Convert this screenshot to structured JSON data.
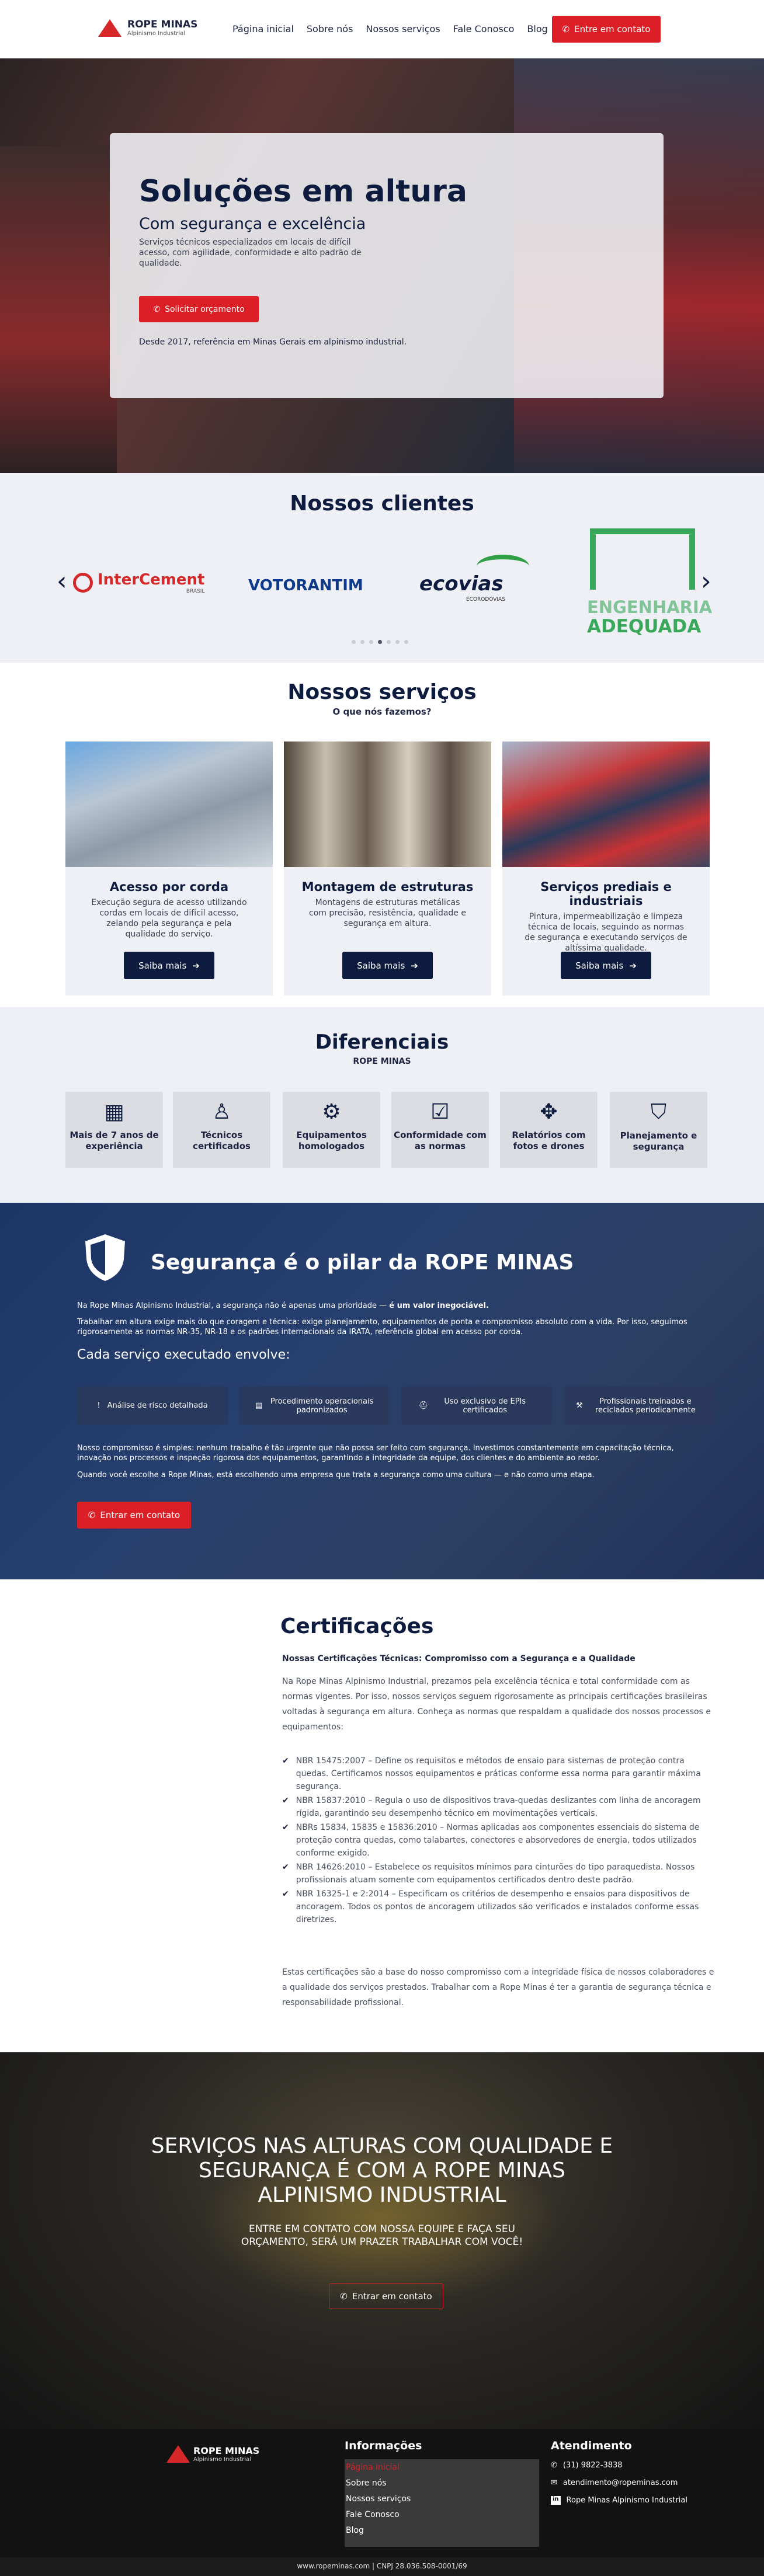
{
  "header": {
    "logo_title": "ROPE MINAS",
    "logo_subtitle": "Alpinismo Industrial",
    "nav": [
      "Página inicial",
      "Sobre nós",
      "Nossos serviços",
      "Fale Conosco",
      "Blog"
    ],
    "cta_label": "Entre em contato"
  },
  "hero": {
    "title": "Soluções em altura",
    "subtitle": "Com segurança e excelência",
    "description": "Serviços técnicos especializados em locais de difícil acesso, com agilidade, conformidade e alto padrão de qualidade.",
    "cta_label": "Solicitar orçamento",
    "note": "Desde 2017, referência em Minas Gerais em alpinismo industrial."
  },
  "clients": {
    "title": "Nossos clientes",
    "logos": [
      "InterCement",
      "VOTORANTIM",
      "ecovias",
      "EA ENGENHARIA ADEQUADA"
    ],
    "intercement_sub": "BRASIL",
    "ecovias_sub": "ECORODOVIAS",
    "ea_line1": "ENGENHARIA",
    "ea_line2": "ADEQUADA",
    "prev": "‹",
    "next": "›"
  },
  "services": {
    "title": "Nossos serviços",
    "subtitle": "O que nós fazemos?",
    "cards": [
      {
        "title": "Acesso por corda",
        "text": "Execução segura de acesso utilizando cordas em locais de difícil acesso, zelando pela segurança e pela qualidade do serviço.",
        "button": "Saiba mais"
      },
      {
        "title": "Montagem de estruturas",
        "text": "Montagens de estruturas metálicas com precisão, resistência, qualidade e segurança em altura.",
        "button": "Saiba mais"
      },
      {
        "title": "Serviços prediais e industriais",
        "text": "Pintura, impermeabilização e limpeza técnica de locais, seguindo as normas de segurança e executando serviços de altíssima qualidade.",
        "button": "Saiba mais"
      }
    ]
  },
  "diferenciais": {
    "title": "Diferenciais",
    "subtitle": "ROPE MINAS",
    "items": [
      {
        "icon": "calendar-icon",
        "glyph": "▦",
        "label": "Mais de 7 anos de experiência"
      },
      {
        "icon": "worker-icon",
        "glyph": "♙",
        "label": "Técnicos certificados"
      },
      {
        "icon": "gears-icon",
        "glyph": "⚙",
        "label": "Equipamentos homologados"
      },
      {
        "icon": "checklist-icon",
        "glyph": "☑",
        "label": "Conformidade com as normas"
      },
      {
        "icon": "drone-icon",
        "glyph": "✥",
        "label": "Relatórios com fotos e drones"
      },
      {
        "icon": "shield-check-icon",
        "glyph": "⛉",
        "label": "Planejamento e segurança"
      }
    ]
  },
  "seguranca": {
    "title": "Segurança é o pilar da ROPE MINAS",
    "p1_start": "Na Rope Minas Alpinismo Industrial, a segurança não é apenas uma prioridade — ",
    "p1_bold": "é um valor inegociável.",
    "p2": "Trabalhar em altura exige mais do que coragem e técnica: exige planejamento, equipamentos de ponta e compromisso absoluto com a vida. Por isso, seguimos rigorosamente as normas NR-35, NR-18 e os padrões internacionais da IRATA, referência global em acesso por corda.",
    "subheading": "Cada serviço executado envolve:",
    "items": [
      {
        "icon": "alert-icon",
        "glyph": "!",
        "label": "Análise de risco detalhada"
      },
      {
        "icon": "procedure-icon",
        "glyph": "▤",
        "label": "Procedimento operacionais padronizados"
      },
      {
        "icon": "epi-icon",
        "glyph": "⛑",
        "label": "Uso exclusivo de EPIs certificados"
      },
      {
        "icon": "training-icon",
        "glyph": "⚒",
        "label": "Profissionais treinados e reciclados periodicamente"
      }
    ],
    "p3": "Nosso compromisso é simples: nenhum trabalho é tão urgente que não possa ser feito com segurança. Investimos constantemente em capacitação técnica, inovação nos processos e inspeção rigorosa dos equipamentos, garantindo a integridade da equipe, dos clientes e do ambiente ao redor.",
    "p4": "Quando você escolhe a Rope Minas, está escolhendo uma empresa que trata a segurança como uma cultura — e não como uma etapa.",
    "cta_label": "Entrar em contato"
  },
  "certificacoes": {
    "title": "Certificações",
    "lead": "Nossas Certificações Técnicas: Compromisso com a Segurança e a Qualidade",
    "intro": "Na Rope Minas Alpinismo Industrial, prezamos pela excelência técnica e total conformidade com as normas vigentes. Por isso, nossos serviços seguem rigorosamente as principais certificações brasileiras voltadas à segurança em altura. Conheça as normas que respaldam a qualidade dos nossos processos e equipamentos:",
    "items": [
      "NBR 15475:2007 – Define os requisitos e métodos de ensaio para sistemas de proteção contra quedas. Certificamos nossos equipamentos e práticas conforme essa norma para garantir máxima segurança.",
      "NBR 15837:2010 – Regula o uso de dispositivos trava-quedas deslizantes com linha de ancoragem rígida, garantindo seu desempenho técnico em movimentações verticais.",
      "NBRs 15834, 15835 e 15836:2010 – Normas aplicadas aos componentes essenciais do sistema de proteção contra quedas, como talabartes, conectores e absorvedores de energia, todos utilizados conforme exigido.",
      "NBR 14626:2010 – Estabelece os requisitos mínimos para cinturões do tipo paraquedista. Nossos profissionais atuam somente com equipamentos certificados dentro deste padrão.",
      "NBR 16325-1 e 2:2014 – Especificam os critérios de desempenho e ensaios para dispositivos de ancoragem. Todos os pontos de ancoragem utilizados são verificados e instalados conforme essas diretrizes."
    ],
    "closing": "Estas certificações são a base do nosso compromisso com a integridade física de nossos colaboradores e a qualidade dos serviços prestados. Trabalhar com a Rope Minas é ter a garantia de segurança técnica e responsabilidade profissional."
  },
  "cta": {
    "title": "SERVIÇOS NAS ALTURAS COM QUALIDADE E SEGURANÇA É COM A ROPE MINAS ALPINISMO INDUSTRIAL",
    "text": "ENTRE EM CONTATO COM NOSSA EQUIPE E FAÇA SEU ORÇAMENTO, SERÁ UM PRAZER TRABALHAR COM VOCÊ!",
    "button": "Entrar em contato"
  },
  "footer": {
    "logo_title": "ROPE MINAS",
    "logo_subtitle": "Alpinismo Industrial",
    "info_title": "Informações",
    "links": [
      "Página inicial",
      "Sobre nós",
      "Nossos serviços",
      "Fale Conosco",
      "Blog"
    ],
    "contact_title": "Atendimento",
    "phone": "(31) 9822-3838",
    "email": "atendimento@ropeminas.com",
    "linkedin": "Rope Minas Alpinismo Industrial",
    "bottom": "www.ropeminas.com | CNPJ 28.036.508-0001/69"
  },
  "colors": {
    "brand_red": "#dc1f26",
    "navy": "#0d1b3e",
    "accent_green": "#3aa85a"
  }
}
